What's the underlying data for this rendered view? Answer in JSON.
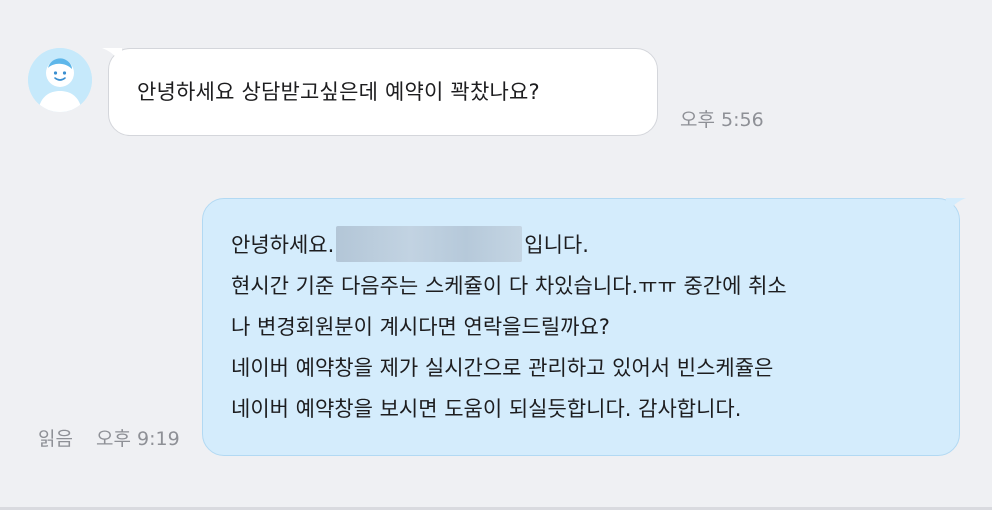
{
  "incoming": {
    "avatar": "user-avatar",
    "message": "안녕하세요 상담받고싶은데 예약이 꽉찼나요?",
    "time": "오후 5:56"
  },
  "outgoing": {
    "line1_before": "안녕하세요.",
    "line1_after": "입니다.",
    "line2": "현시간 기준 다음주는 스케쥴이 다 차있습니다.ㅠㅠ 중간에 취소",
    "line3": "나 변경회원분이 계시다면 연락을드릴까요?",
    "line4": "네이버 예약창을 제가 실시간으로 관리하고 있어서 빈스케쥴은",
    "line5": "네이버 예약창을 보시면 도움이 되실듯합니다. 감사합니다.",
    "read_label": "읽음",
    "time": "오후 9:19"
  },
  "colors": {
    "background": "#eff0f3",
    "incoming_bubble": "#ffffff",
    "outgoing_bubble": "#d4ecfc",
    "avatar_bg": "#c6e9fb",
    "meta_text": "#8e9096"
  }
}
